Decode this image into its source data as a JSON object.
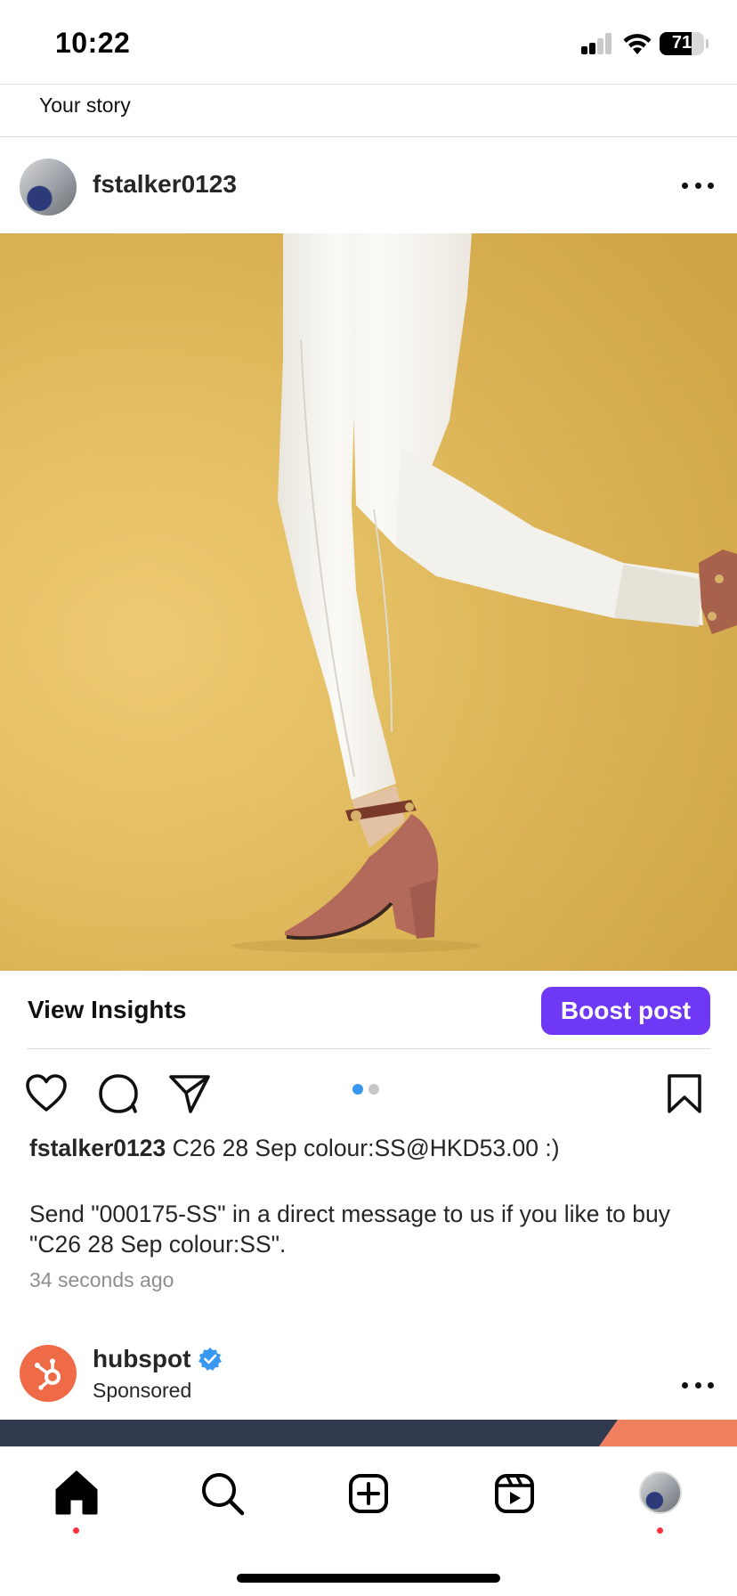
{
  "status_bar": {
    "time": "10:22",
    "battery_percent": 71,
    "battery_label": "71",
    "signal_bars": 2
  },
  "stories": {
    "your_story_label": "Your story"
  },
  "post": {
    "username": "fstalker0123",
    "view_insights_label": "View Insights",
    "boost_label": "Boost post",
    "carousel_pages": 2,
    "carousel_active_index": 0,
    "caption_user": "fstalker0123",
    "caption_text": "C26 28 Sep colour:SS@HKD53.00 :)",
    "caption_message": "Send \"000175-SS\" in a direct message to us if you like to buy \"C26 28 Sep colour:SS\".",
    "timestamp": "34 seconds ago"
  },
  "sponsored_post": {
    "username": "hubspot",
    "verified": true,
    "label": "Sponsored",
    "brand_color": "#ef6b47"
  },
  "tab_bar": {
    "items": [
      "home-icon",
      "search-icon",
      "create-icon",
      "reels-icon",
      "profile-avatar"
    ],
    "active": "home-icon"
  },
  "colors": {
    "accent_boost": "#6f38f5",
    "carousel_active": "#3897f0",
    "notification_dot": "#ff3040",
    "photo_background": "#e2bc5e"
  }
}
